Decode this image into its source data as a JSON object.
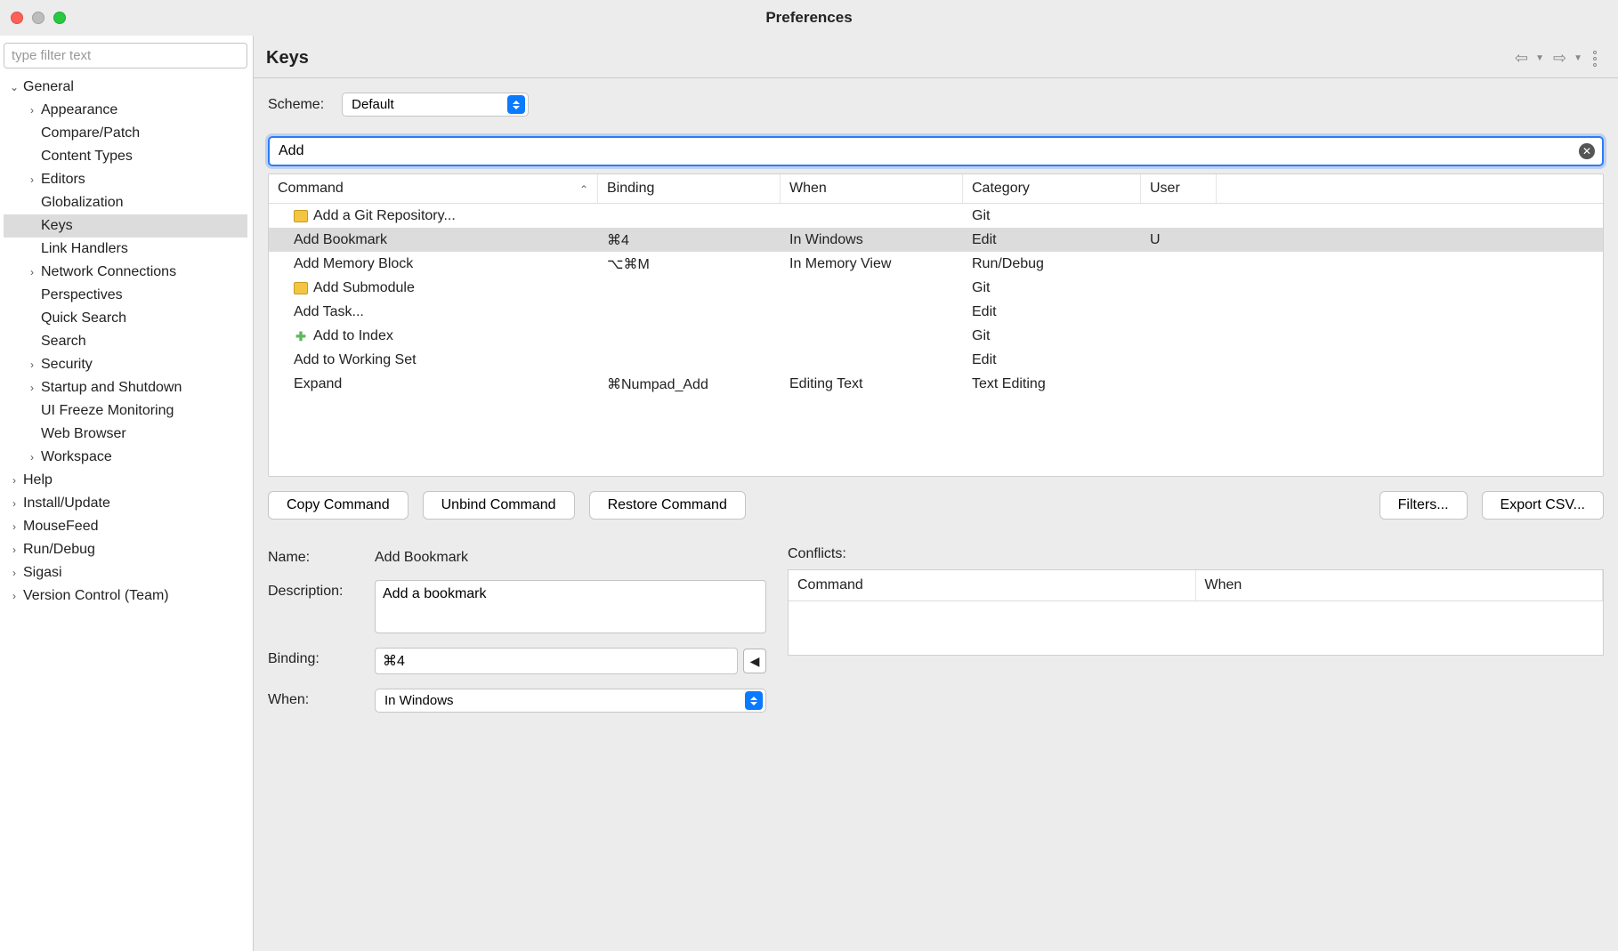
{
  "window": {
    "title": "Preferences"
  },
  "sidebar": {
    "filter_placeholder": "type filter text",
    "nodes": [
      {
        "label": "General",
        "depth": 0,
        "arrow": "down",
        "selected": false
      },
      {
        "label": "Appearance",
        "depth": 1,
        "arrow": "right",
        "selected": false
      },
      {
        "label": "Compare/Patch",
        "depth": 1,
        "arrow": "none",
        "selected": false
      },
      {
        "label": "Content Types",
        "depth": 1,
        "arrow": "none",
        "selected": false
      },
      {
        "label": "Editors",
        "depth": 1,
        "arrow": "right",
        "selected": false
      },
      {
        "label": "Globalization",
        "depth": 1,
        "arrow": "none",
        "selected": false
      },
      {
        "label": "Keys",
        "depth": 1,
        "arrow": "none",
        "selected": true
      },
      {
        "label": "Link Handlers",
        "depth": 1,
        "arrow": "none",
        "selected": false
      },
      {
        "label": "Network Connections",
        "depth": 1,
        "arrow": "right",
        "selected": false
      },
      {
        "label": "Perspectives",
        "depth": 1,
        "arrow": "none",
        "selected": false
      },
      {
        "label": "Quick Search",
        "depth": 1,
        "arrow": "none",
        "selected": false
      },
      {
        "label": "Search",
        "depth": 1,
        "arrow": "none",
        "selected": false
      },
      {
        "label": "Security",
        "depth": 1,
        "arrow": "right",
        "selected": false
      },
      {
        "label": "Startup and Shutdown",
        "depth": 1,
        "arrow": "right",
        "selected": false
      },
      {
        "label": "UI Freeze Monitoring",
        "depth": 1,
        "arrow": "none",
        "selected": false
      },
      {
        "label": "Web Browser",
        "depth": 1,
        "arrow": "none",
        "selected": false
      },
      {
        "label": "Workspace",
        "depth": 1,
        "arrow": "right",
        "selected": false
      },
      {
        "label": "Help",
        "depth": 0,
        "arrow": "right",
        "selected": false
      },
      {
        "label": "Install/Update",
        "depth": 0,
        "arrow": "right",
        "selected": false
      },
      {
        "label": "MouseFeed",
        "depth": 0,
        "arrow": "right",
        "selected": false
      },
      {
        "label": "Run/Debug",
        "depth": 0,
        "arrow": "right",
        "selected": false
      },
      {
        "label": "Sigasi",
        "depth": 0,
        "arrow": "right",
        "selected": false
      },
      {
        "label": "Version Control (Team)",
        "depth": 0,
        "arrow": "right",
        "selected": false
      }
    ]
  },
  "page": {
    "title": "Keys"
  },
  "scheme": {
    "label": "Scheme:",
    "value": "Default"
  },
  "search": {
    "value": "Add"
  },
  "table": {
    "headers": {
      "command": "Command",
      "binding": "Binding",
      "when": "When",
      "category": "Category",
      "user": "User"
    },
    "rows": [
      {
        "command": "Add a Git Repository...",
        "icon": "folder",
        "binding": "",
        "when": "",
        "category": "Git",
        "user": "",
        "selected": false
      },
      {
        "command": "Add Bookmark",
        "icon": "",
        "binding": "⌘4",
        "when": "In Windows",
        "category": "Edit",
        "user": "U",
        "selected": true
      },
      {
        "command": "Add Memory Block",
        "icon": "",
        "binding": "⌥⌘M",
        "when": "In Memory View",
        "category": "Run/Debug",
        "user": "",
        "selected": false
      },
      {
        "command": "Add Submodule",
        "icon": "folder",
        "binding": "",
        "when": "",
        "category": "Git",
        "user": "",
        "selected": false
      },
      {
        "command": "Add Task...",
        "icon": "",
        "binding": "",
        "when": "",
        "category": "Edit",
        "user": "",
        "selected": false
      },
      {
        "command": "Add to Index",
        "icon": "plus",
        "binding": "",
        "when": "",
        "category": "Git",
        "user": "",
        "selected": false
      },
      {
        "command": "Add to Working Set",
        "icon": "",
        "binding": "",
        "when": "",
        "category": "Edit",
        "user": "",
        "selected": false
      },
      {
        "command": "Expand",
        "icon": "",
        "binding": "⌘Numpad_Add",
        "when": "Editing Text",
        "category": "Text Editing",
        "user": "",
        "selected": false
      }
    ]
  },
  "buttons": {
    "copy": "Copy Command",
    "unbind": "Unbind Command",
    "restore": "Restore Command",
    "filters": "Filters...",
    "export": "Export CSV..."
  },
  "detail": {
    "name_label": "Name:",
    "name_value": "Add Bookmark",
    "desc_label": "Description:",
    "desc_value": "Add a bookmark",
    "binding_label": "Binding:",
    "binding_value": "⌘4",
    "when_label": "When:",
    "when_value": "In Windows"
  },
  "conflicts": {
    "label": "Conflicts:",
    "command_header": "Command",
    "when_header": "When"
  }
}
